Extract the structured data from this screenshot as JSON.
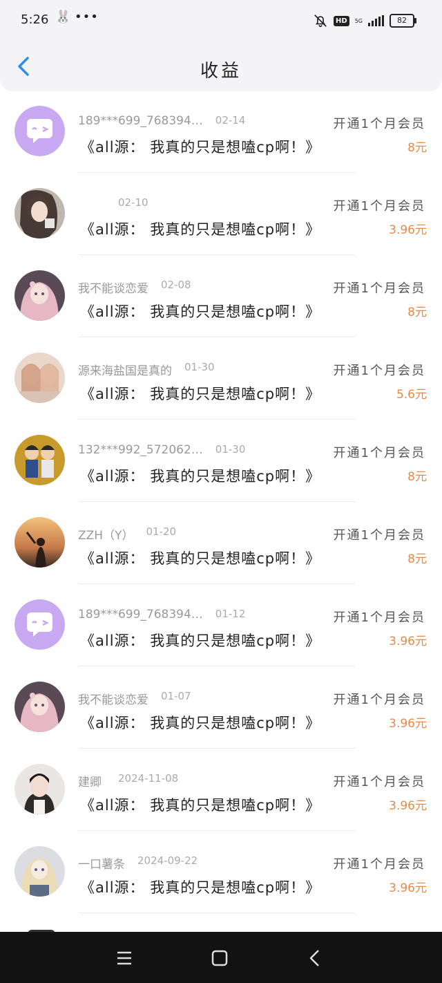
{
  "status": {
    "time": "5:26",
    "network": "5G",
    "hd": "HD",
    "battery": "82"
  },
  "header": {
    "title": "收益"
  },
  "records": [
    {
      "user": "189***699_768394…",
      "date": "02-14",
      "title": "《all源： 我真的只是想嗑cp啊！》",
      "action": "开通1个月会员",
      "amount": "8元",
      "avatar": "bubble-avatar"
    },
    {
      "user": "",
      "date": "02-10",
      "title": "《all源： 我真的只是想嗑cp啊！》",
      "action": "开通1个月会员",
      "amount": "3.96元",
      "avatar": "girl-photo-avatar"
    },
    {
      "user": "我不能谈恋爱",
      "date": "02-08",
      "title": "《all源： 我真的只是想嗑cp啊！》",
      "action": "开通1个月会员",
      "amount": "8元",
      "avatar": "anime-pink-avatar"
    },
    {
      "user": "源来海盐国是真的",
      "date": "01-30",
      "title": "《all源： 我真的只是想嗑cp啊！》",
      "action": "开通1个月会员",
      "amount": "5.6元",
      "avatar": "two-girls-avatar"
    },
    {
      "user": "132***992_572062…",
      "date": "01-30",
      "title": "《all源： 我真的只是想嗑cp啊！》",
      "action": "开通1个月会员",
      "amount": "8元",
      "avatar": "cartoon-boys-avatar"
    },
    {
      "user": "ZZH（Y）",
      "date": "01-20",
      "title": "《all源： 我真的只是想嗑cp啊！》",
      "action": "开通1个月会员",
      "amount": "8元",
      "avatar": "sunset-avatar"
    },
    {
      "user": "189***699_768394…",
      "date": "01-12",
      "title": "《all源： 我真的只是想嗑cp啊！》",
      "action": "开通1个月会员",
      "amount": "3.96元",
      "avatar": "bubble-avatar"
    },
    {
      "user": "我不能谈恋爱",
      "date": "01-07",
      "title": "《all源： 我真的只是想嗑cp啊！》",
      "action": "开通1个月会员",
      "amount": "3.96元",
      "avatar": "anime-pink-avatar"
    },
    {
      "user": "建卿",
      "date": "2024-11-08",
      "title": "《all源： 我真的只是想嗑cp啊！》",
      "action": "开通1个月会员",
      "amount": "3.96元",
      "avatar": "portrait-avatar"
    },
    {
      "user": "一口薯条",
      "date": "2024-09-22",
      "title": "《all源： 我真的只是想嗑cp啊！》",
      "action": "开通1个月会员",
      "amount": "3.96元",
      "avatar": "anime-blonde-avatar"
    }
  ],
  "colors": {
    "amount": "#e58a4a",
    "back": "#2f8de4",
    "bubble": "#c8a8f0"
  },
  "icons": {
    "back": "chevron-left-icon",
    "nav": [
      "menu-icon",
      "home-square-icon",
      "back-triangle-icon"
    ]
  }
}
